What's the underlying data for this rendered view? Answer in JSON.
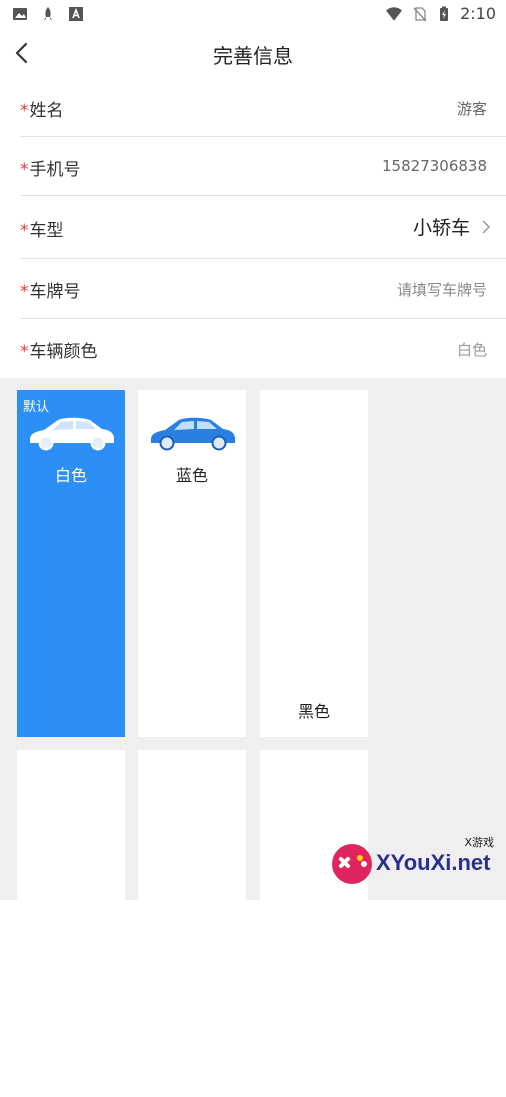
{
  "status_bar": {
    "time": "2:10",
    "icons": [
      "image-icon",
      "rocket-icon",
      "font-a-icon",
      "wifi-icon",
      "no-sim-icon",
      "battery-charging-icon"
    ]
  },
  "nav": {
    "title": "完善信息",
    "back_icon": "chevron-left-icon"
  },
  "form": {
    "required_mark": "*",
    "name": {
      "label": "姓名",
      "value": "游客"
    },
    "phone": {
      "label": "手机号",
      "value": "15827306838"
    },
    "car_type": {
      "label": "车型",
      "value": "小轿车"
    },
    "plate": {
      "label": "车牌号",
      "placeholder": "请填写车牌号"
    },
    "color": {
      "label": "车辆颜色",
      "value": "白色"
    }
  },
  "colors": {
    "default_tag": "默认",
    "items": [
      {
        "name": "白色",
        "selected": true,
        "car_color": "#ffffff"
      },
      {
        "name": "蓝色",
        "selected": false,
        "car_color": "#2b7fe0"
      },
      {
        "name": "黑色",
        "selected": false,
        "car_color": null
      },
      {
        "name": "",
        "selected": false
      },
      {
        "name": "",
        "selected": false
      },
      {
        "name": "",
        "selected": false
      }
    ],
    "accent": "#2b8ff6"
  },
  "watermark": {
    "text": "XYouXi.net",
    "small": "X游戏"
  }
}
